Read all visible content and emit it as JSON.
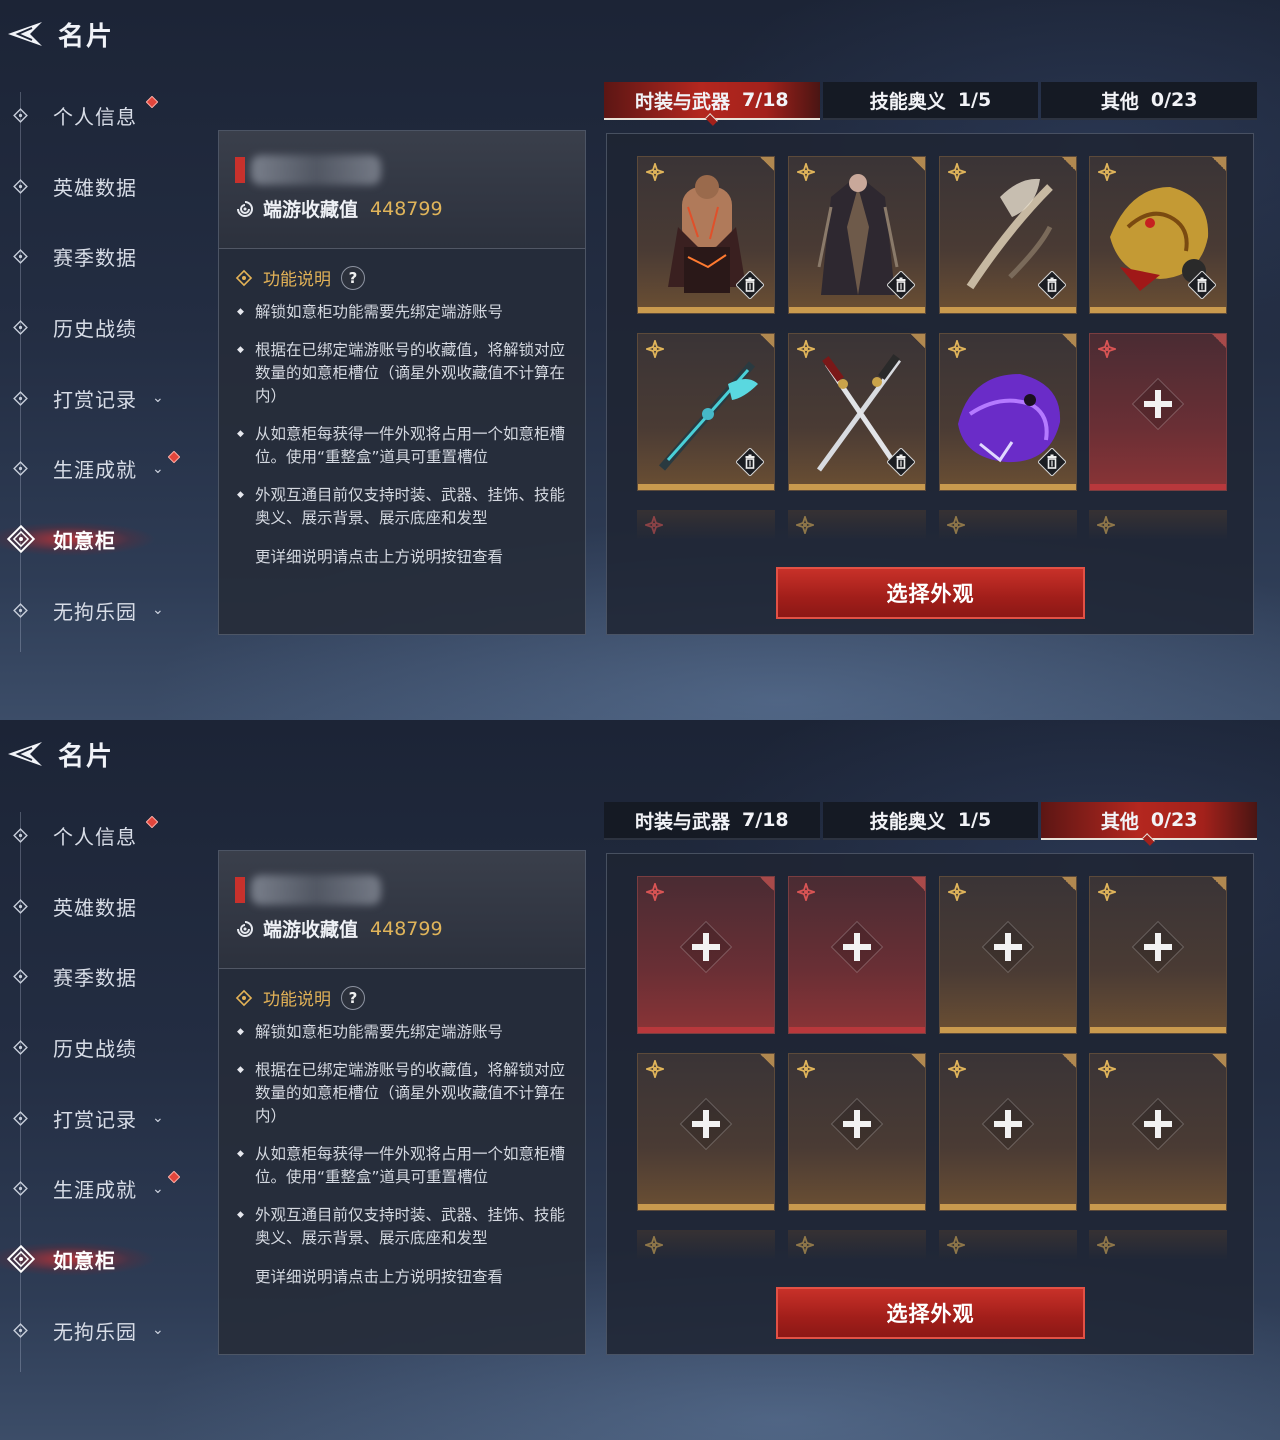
{
  "header": {
    "title": "名片",
    "back_icon": "back-arrow-icon"
  },
  "sidebar": {
    "items": [
      {
        "label": "个人信息",
        "badge": true,
        "chevron": false
      },
      {
        "label": "英雄数据",
        "badge": false,
        "chevron": false
      },
      {
        "label": "赛季数据",
        "badge": false,
        "chevron": false
      },
      {
        "label": "历史战绩",
        "badge": false,
        "chevron": false
      },
      {
        "label": "打赏记录",
        "badge": false,
        "chevron": true
      },
      {
        "label": "生涯成就",
        "badge": true,
        "chevron": true
      },
      {
        "label": "如意柜",
        "badge": false,
        "chevron": false,
        "active": true
      },
      {
        "label": "无拘乐园",
        "badge": false,
        "chevron": true
      }
    ],
    "chevron_glyph": "⌄"
  },
  "info": {
    "score_label": "端游收藏值",
    "score_value": "448799",
    "func_label": "功能说明",
    "help_glyph": "?",
    "bullets": [
      "解锁如意柜功能需要先绑定端游账号",
      "根据在已绑定端游账号的收藏值，将解锁对应数量的如意柜槽位（谪星外观收藏值不计算在内）",
      "从如意柜每获得一件外观将占用一个如意柜槽位。使用“重整盒”道具可重置槽位",
      "外观互通目前仅支持时装、武器、挂饰、技能奥义、展示背景、展示底座和发型"
    ],
    "more": "更详细说明请点击上方说明按钮查看"
  },
  "tabs": [
    {
      "name": "时装与武器",
      "count": "7/18"
    },
    {
      "name": "技能奥义",
      "count": "1/5"
    },
    {
      "name": "其他",
      "count": "0/23"
    }
  ],
  "select_button": "选择外观",
  "screens": [
    {
      "active_tab": 0,
      "slots": [
        {
          "type": "item",
          "art": "outfit-bare-chest",
          "rarity": "gold"
        },
        {
          "type": "item",
          "art": "outfit-dark-robe",
          "rarity": "gold"
        },
        {
          "type": "item",
          "art": "weapon-bone-bow",
          "rarity": "gold"
        },
        {
          "type": "item",
          "art": "accessory-golden-dragon",
          "rarity": "gold"
        },
        {
          "type": "item",
          "art": "weapon-cyan-spear",
          "rarity": "gold"
        },
        {
          "type": "item",
          "art": "weapon-twin-katana",
          "rarity": "gold"
        },
        {
          "type": "item",
          "art": "accessory-purple-beast",
          "rarity": "gold"
        },
        {
          "type": "empty",
          "rarity": "red"
        }
      ],
      "peek_rarity": [
        "red",
        "gold",
        "gold",
        "gold"
      ]
    },
    {
      "active_tab": 2,
      "slots": [
        {
          "type": "empty",
          "rarity": "red"
        },
        {
          "type": "empty",
          "rarity": "red"
        },
        {
          "type": "empty",
          "rarity": "gold"
        },
        {
          "type": "empty",
          "rarity": "gold"
        },
        {
          "type": "empty",
          "rarity": "gold"
        },
        {
          "type": "empty",
          "rarity": "gold"
        },
        {
          "type": "empty",
          "rarity": "gold"
        },
        {
          "type": "empty",
          "rarity": "gold"
        }
      ],
      "peek_rarity": [
        "gold",
        "gold",
        "gold",
        "gold"
      ]
    }
  ],
  "colors": {
    "accent_red": "#b4271f",
    "gold": "#e0b45a",
    "text": "#e6e8ee"
  }
}
